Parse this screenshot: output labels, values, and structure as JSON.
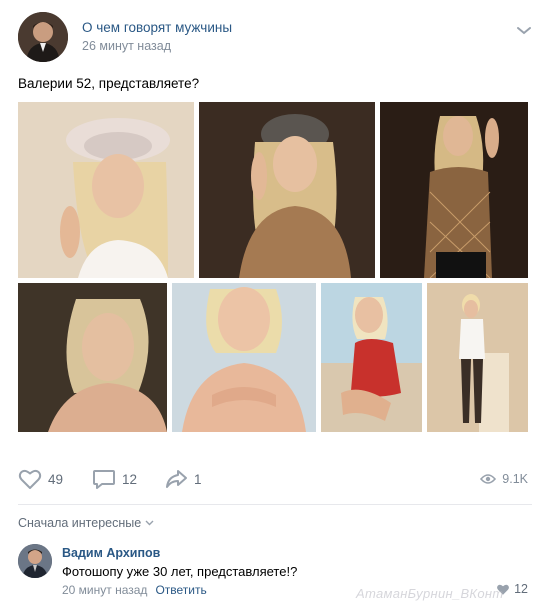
{
  "post": {
    "group_name": "О чем говорят мужчины",
    "time": "26 минут назад",
    "text": "Валерии 52, представляете?"
  },
  "photos": [
    {
      "name": "photo-1",
      "alt": "Woman in white hat",
      "bg": "#d9cbb8"
    },
    {
      "name": "photo-2",
      "alt": "Woman in knit cap",
      "bg": "#3a2a20"
    },
    {
      "name": "photo-3",
      "alt": "Woman in mesh top",
      "bg": "#2b1e16"
    },
    {
      "name": "photo-4",
      "alt": "Woman portrait dark",
      "bg": "#3d3228"
    },
    {
      "name": "photo-5",
      "alt": "Woman portrait light",
      "bg": "#cfd8de"
    },
    {
      "name": "photo-6",
      "alt": "Woman on beach",
      "bg": "#b9cfd9"
    },
    {
      "name": "photo-7",
      "alt": "Woman in studio",
      "bg": "#d8c3a6"
    }
  ],
  "actions": {
    "likes": "49",
    "comments": "12",
    "shares": "1",
    "views": "9.1K"
  },
  "comments_section": {
    "sort_label": "Сначала интересные"
  },
  "comment": {
    "author": "Вадим Архипов",
    "text": "Фотошопу уже 30 лет, представляете!?",
    "time": "20 минут назад",
    "reply_label": "Ответить",
    "likes": "12"
  },
  "watermark": "АтаманБурнин_ВКонт",
  "colors": {
    "link": "#2a5885",
    "muted": "#818c99",
    "icon": "#99a2ad"
  }
}
